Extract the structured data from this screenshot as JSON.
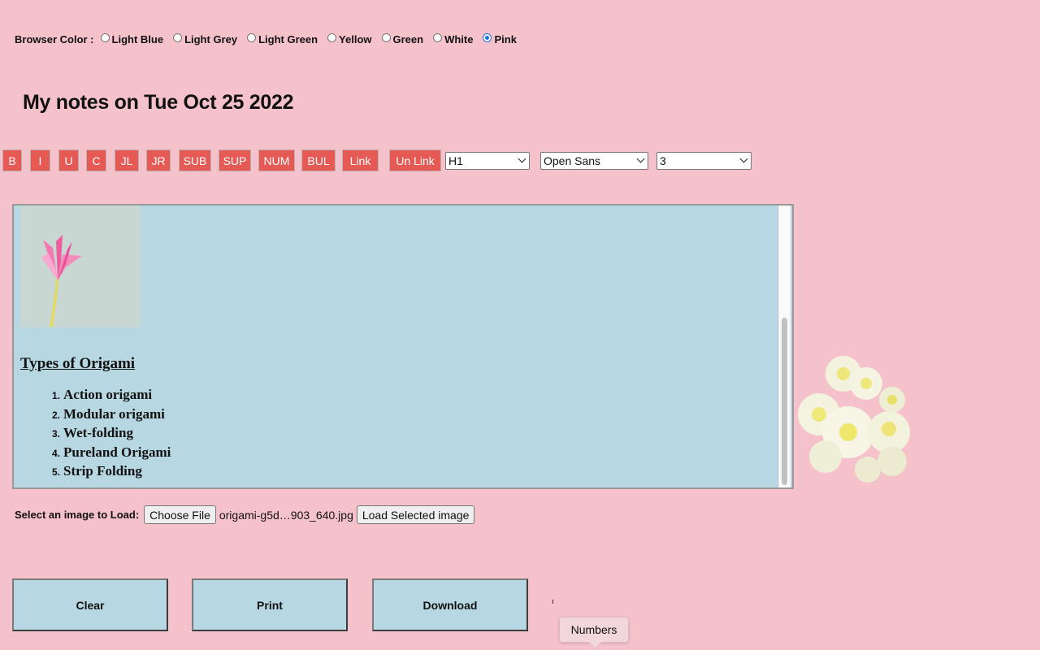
{
  "browser_color": {
    "label": "Browser Color :",
    "options": [
      "Light Blue",
      "Light Grey",
      "Light Green",
      "Yellow",
      "Green",
      "White",
      "Pink"
    ],
    "selected": "Pink"
  },
  "title": "My notes on Tue Oct 25 2022",
  "toolbar": {
    "buttons": [
      "B",
      "I",
      "U",
      "C",
      "JL",
      "JR",
      "SUB",
      "SUP",
      "NUM",
      "BUL",
      "Link",
      "Un Link"
    ],
    "heading_select": "H1",
    "font_select": "Open Sans",
    "size_select": "3"
  },
  "editor": {
    "heading": "Types of Origami",
    "list": [
      {
        "num": "1.",
        "text": "Action origami"
      },
      {
        "num": "2.",
        "text": "Modular origami"
      },
      {
        "num": "3.",
        "text": "Wet-folding"
      },
      {
        "num": "4.",
        "text": "Pureland Origami"
      },
      {
        "num": "5.",
        "text": "Strip Folding"
      }
    ]
  },
  "file_load": {
    "label": "Select an image to Load:",
    "choose_button": "Choose File",
    "file_name": "origami-g5d…903_640.jpg",
    "load_button": "Load Selected image"
  },
  "actions": {
    "clear": "Clear",
    "print": "Print",
    "download": "Download"
  },
  "tooltip": "Numbers",
  "colors": {
    "background": "#f5c2cc",
    "editor_bg": "#b7d8e2",
    "toolbar_button": "#e55a54",
    "radio_selected": "#1a73e8"
  }
}
